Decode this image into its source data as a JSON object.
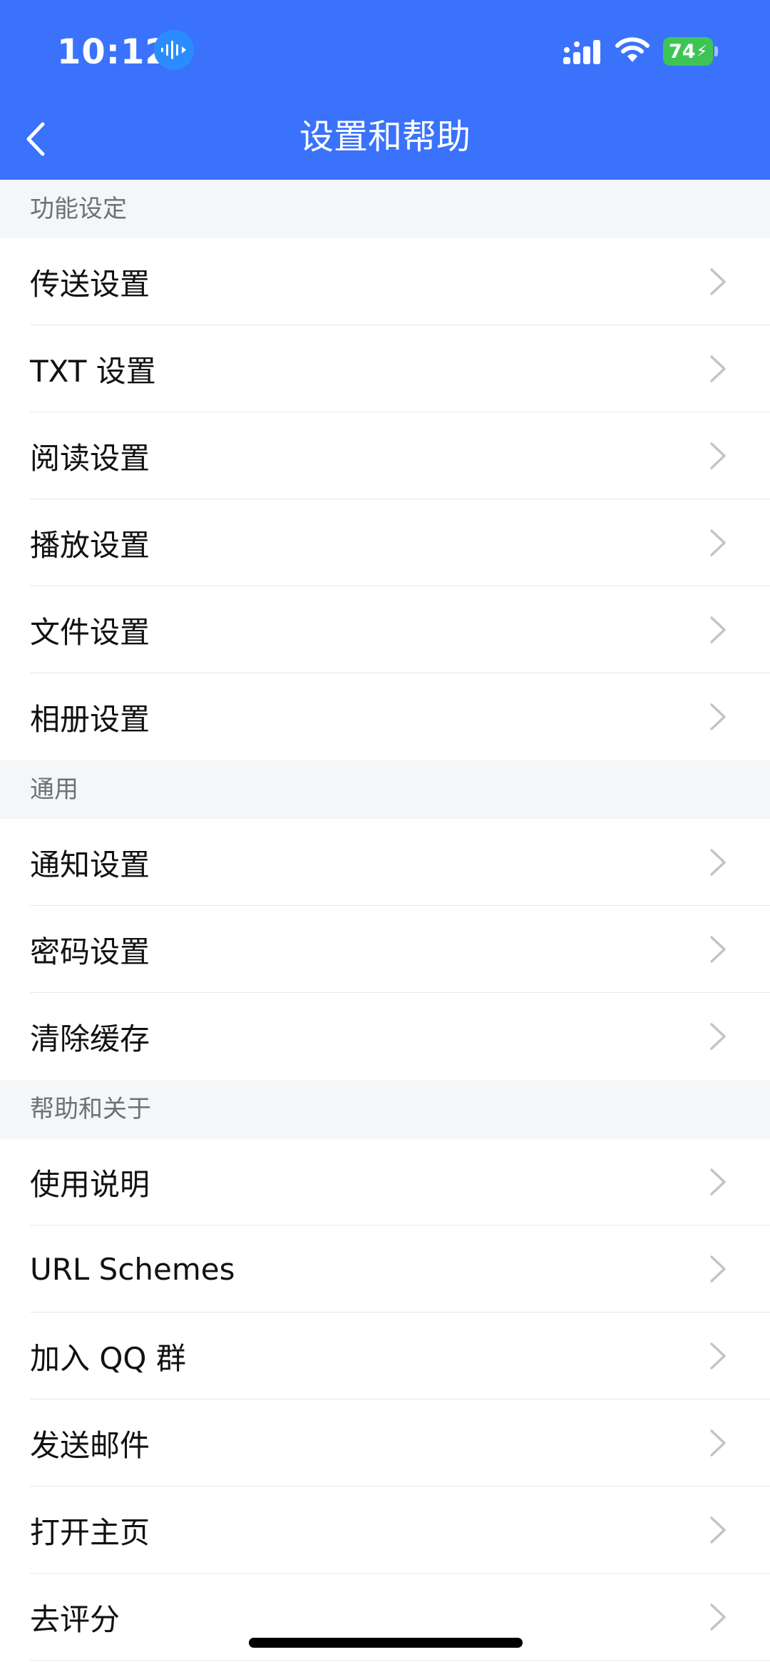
{
  "status_bar": {
    "time": "10:12",
    "battery": "74"
  },
  "nav": {
    "title": "设置和帮助"
  },
  "sections": [
    {
      "title": "功能设定",
      "items": [
        {
          "label": "传送设置"
        },
        {
          "label": "TXT 设置"
        },
        {
          "label": "阅读设置"
        },
        {
          "label": "播放设置"
        },
        {
          "label": "文件设置"
        },
        {
          "label": "相册设置"
        }
      ]
    },
    {
      "title": "通用",
      "items": [
        {
          "label": "通知设置"
        },
        {
          "label": "密码设置"
        },
        {
          "label": "清除缓存"
        }
      ]
    },
    {
      "title": "帮助和关于",
      "items": [
        {
          "label": "使用说明"
        },
        {
          "label": "URL Schemes"
        },
        {
          "label": "加入 QQ 群"
        },
        {
          "label": "发送邮件"
        },
        {
          "label": "打开主页"
        },
        {
          "label": "去评分"
        }
      ]
    }
  ],
  "colors": {
    "header_bg": "#3a72fb",
    "section_bg": "#f5f6f8",
    "battery": "#3ec455"
  }
}
